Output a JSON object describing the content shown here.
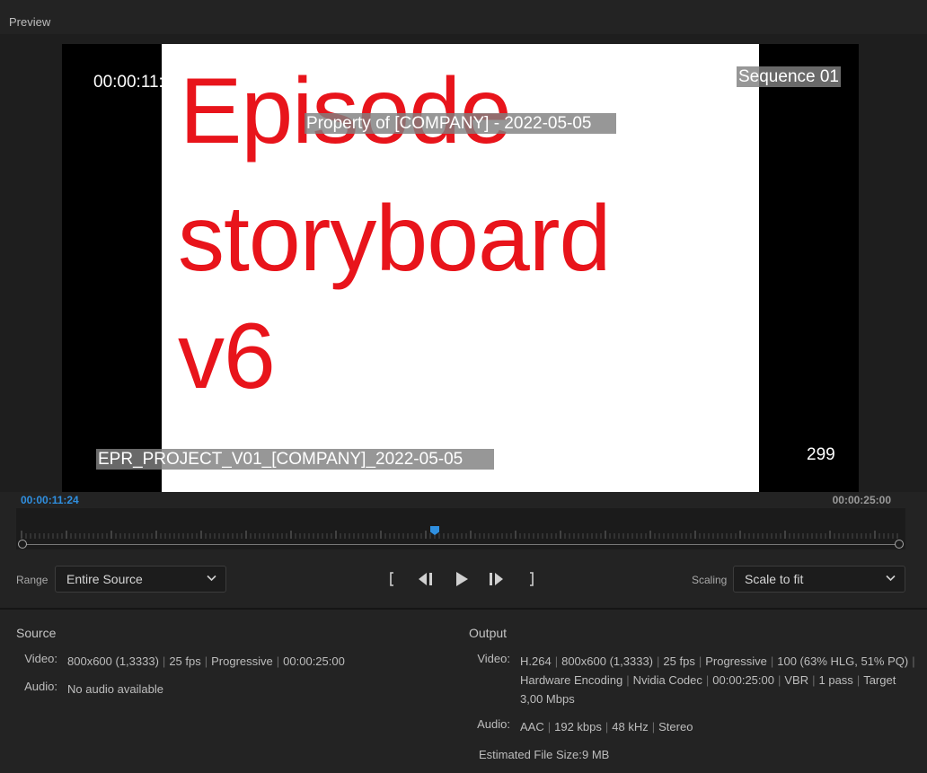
{
  "panel": {
    "title": "Preview"
  },
  "video": {
    "content_lines": [
      "Episode",
      "storyboard",
      "v6"
    ],
    "burnins": {
      "timecode": "00:00:11:24",
      "sequence": "Sequence 01",
      "watermark": "Property of [COMPANY] - 2022-05-05",
      "filename": "EPR_PROJECT_V01_[COMPANY]_2022-05-05",
      "frame": "299"
    }
  },
  "timeline": {
    "current": "00:00:11:24",
    "total": "00:00:25:00"
  },
  "controls": {
    "range_label": "Range",
    "range_value": "Entire Source",
    "scaling_label": "Scaling",
    "scaling_value": "Scale to fit"
  },
  "source": {
    "title": "Source",
    "video_key": "Video:",
    "video_parts": [
      "800x600 (1,3333)",
      "25 fps",
      "Progressive",
      "00:00:25:00"
    ],
    "audio_key": "Audio:",
    "audio_value": "No audio available"
  },
  "output": {
    "title": "Output",
    "video_key": "Video:",
    "video_line1": [
      "H.264",
      "800x600 (1,3333)",
      "25 fps",
      "Progressive",
      "100 (63% HLG, 51% PQ)"
    ],
    "video_line2": [
      "Hardware Encoding",
      "Nvidia Codec",
      "00:00:25:00",
      "VBR",
      "1 pass",
      "Target"
    ],
    "video_line3": "3,00 Mbps",
    "audio_key": "Audio:",
    "audio_parts": [
      "AAC",
      "192 kbps",
      "48 kHz",
      "Stereo"
    ],
    "filesize_key": "Estimated File Size:",
    "filesize_value": "9 MB"
  },
  "colors": {
    "accent": "#2f8fe0",
    "content_text": "#e8141b"
  },
  "icons": [
    "chevron-down-icon",
    "mark-in-icon",
    "step-back-icon",
    "play-icon",
    "step-forward-icon",
    "mark-out-icon"
  ]
}
